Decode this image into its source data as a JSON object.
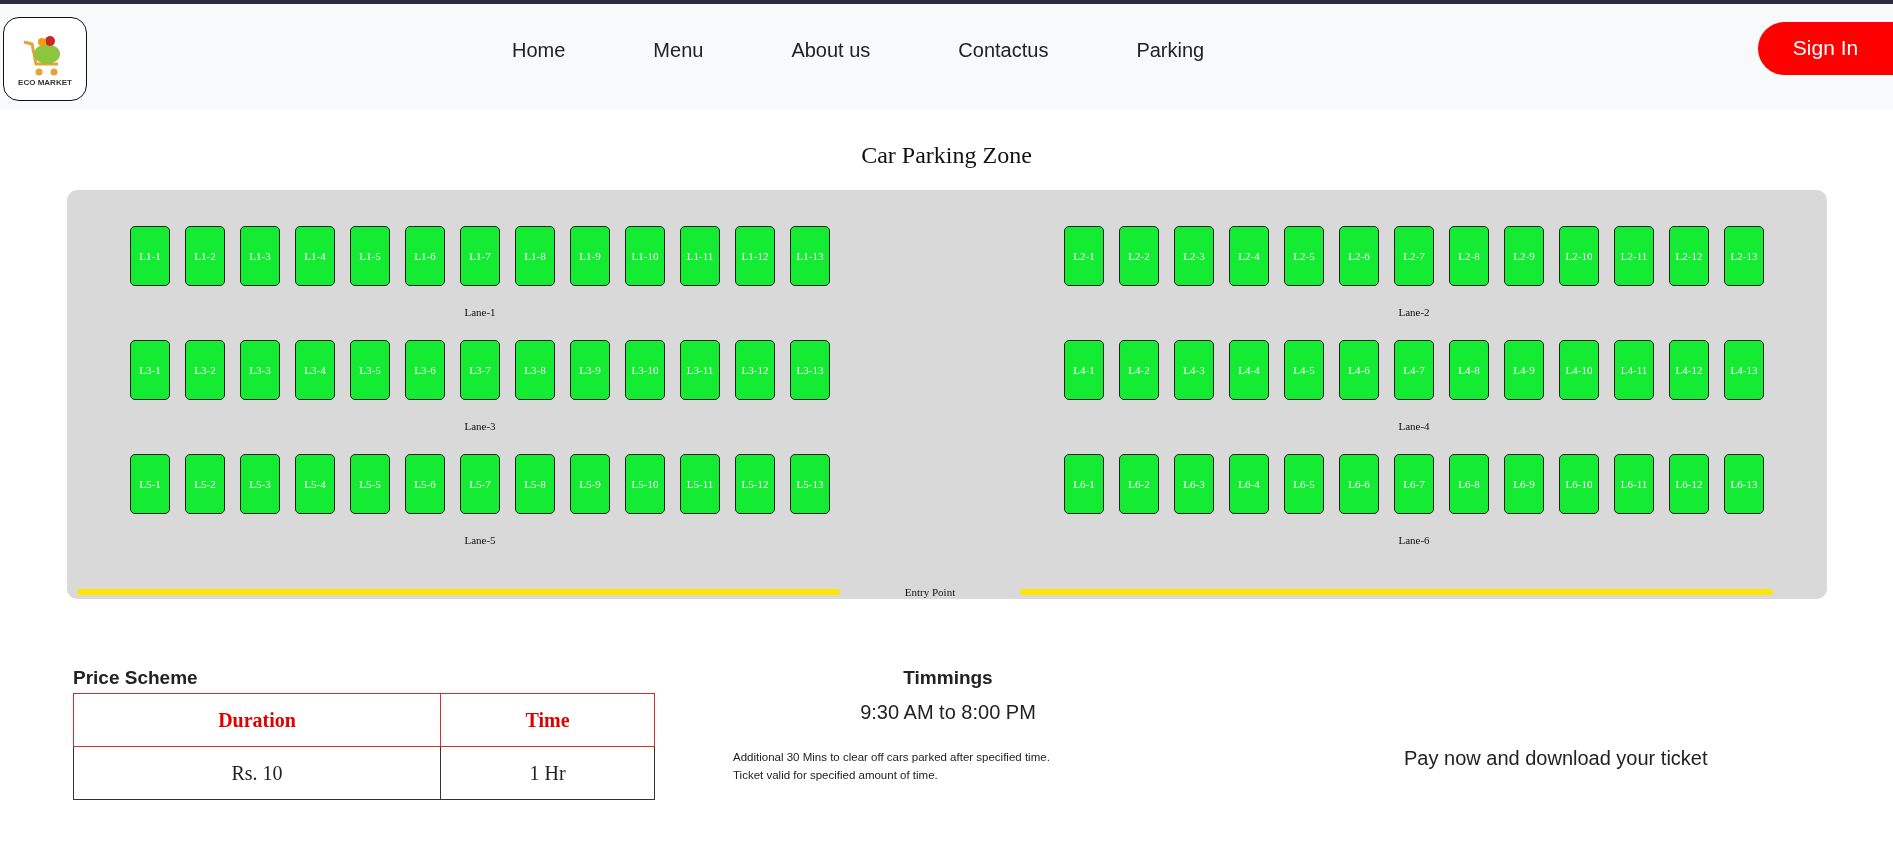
{
  "header": {
    "logo_text": "ECO MARKET",
    "nav": [
      {
        "label": "Home"
      },
      {
        "label": "Menu"
      },
      {
        "label": "About us"
      },
      {
        "label": "Contactus"
      },
      {
        "label": "Parking"
      }
    ],
    "sign_in": "Sign In"
  },
  "parking": {
    "title": "Car Parking Zone",
    "entry_label": "Entry Point",
    "lanes": [
      {
        "label": "Lane-1",
        "slots": [
          "L1-1",
          "L1-2",
          "L1-3",
          "L1-4",
          "L1-5",
          "L1-6",
          "L1-7",
          "L1-8",
          "L1-9",
          "L1-10",
          "L1-11",
          "L1-12",
          "L1-13"
        ]
      },
      {
        "label": "Lane-2",
        "slots": [
          "L2-1",
          "L2-2",
          "L2-3",
          "L2-4",
          "L2-5",
          "L2-6",
          "L2-7",
          "L2-8",
          "L2-9",
          "L2-10",
          "L2-11",
          "L2-12",
          "L2-13"
        ]
      },
      {
        "label": "Lane-3",
        "slots": [
          "L3-1",
          "L3-2",
          "L3-3",
          "L3-4",
          "L3-5",
          "L3-6",
          "L3-7",
          "L3-8",
          "L3-9",
          "L3-10",
          "L3-11",
          "L3-12",
          "L3-13"
        ]
      },
      {
        "label": "Lane-4",
        "slots": [
          "L4-1",
          "L4-2",
          "L4-3",
          "L4-4",
          "L4-5",
          "L4-6",
          "L4-7",
          "L4-8",
          "L4-9",
          "L4-10",
          "L4-11",
          "L4-12",
          "L4-13"
        ]
      },
      {
        "label": "Lane-5",
        "slots": [
          "L5-1",
          "L5-2",
          "L5-3",
          "L5-4",
          "L5-5",
          "L5-6",
          "L5-7",
          "L5-8",
          "L5-9",
          "L5-10",
          "L5-11",
          "L5-12",
          "L5-13"
        ]
      },
      {
        "label": "Lane-6",
        "slots": [
          "L6-1",
          "L6-2",
          "L6-3",
          "L6-4",
          "L6-5",
          "L6-6",
          "L6-7",
          "L6-8",
          "L6-9",
          "L6-10",
          "L6-11",
          "L6-12",
          "L6-13"
        ]
      }
    ]
  },
  "price_scheme": {
    "title": "Price Scheme",
    "columns": [
      "Duration",
      "Time"
    ],
    "rows": [
      [
        "Rs. 10",
        "1 Hr"
      ]
    ]
  },
  "timings": {
    "title": "Timmings",
    "hours": "9:30 AM to 8:00 PM",
    "notes": [
      "Additional 30 Mins to clear off cars parked after specified time.",
      "Ticket valid for specified amount of time."
    ]
  },
  "pay": {
    "text": "Pay now and download your ticket"
  }
}
